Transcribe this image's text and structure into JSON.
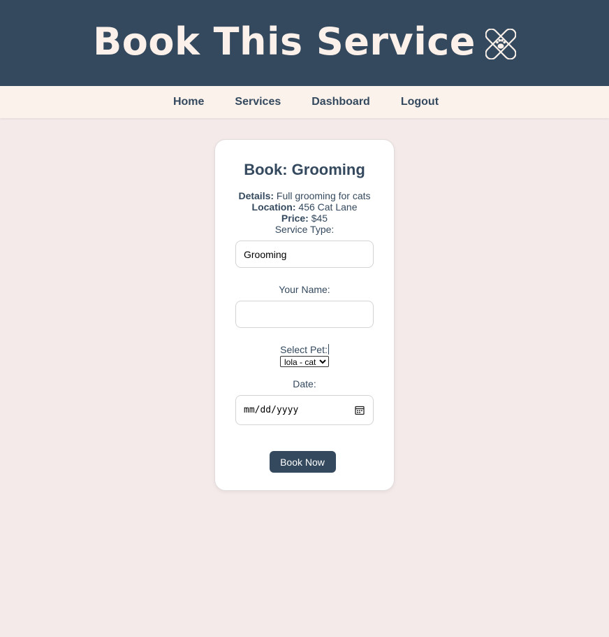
{
  "header": {
    "title": "Book This Service",
    "logo_icon": "bandage-paw-icon"
  },
  "nav": {
    "items": [
      "Home",
      "Services",
      "Dashboard",
      "Logout"
    ]
  },
  "booking": {
    "heading": "Book: Grooming",
    "details_label": "Details:",
    "details_value": "Full grooming for cats",
    "location_label": "Location:",
    "location_value": "456 Cat Lane",
    "price_label": "Price:",
    "price_value": "$45",
    "service_type_label": "Service Type:",
    "service_type_value": "Grooming",
    "name_label": "Your Name:",
    "name_value": "",
    "pet_label": "Select Pet:",
    "pet_selected": "lola - cat",
    "date_label": "Date:",
    "date_placeholder": "mm/dd/yyyy",
    "submit_label": "Book Now"
  },
  "colors": {
    "primary": "#34495e",
    "nav_bg": "#fcf2ec",
    "page_bg": "#f4eaea",
    "card_bg": "#ffffff"
  }
}
